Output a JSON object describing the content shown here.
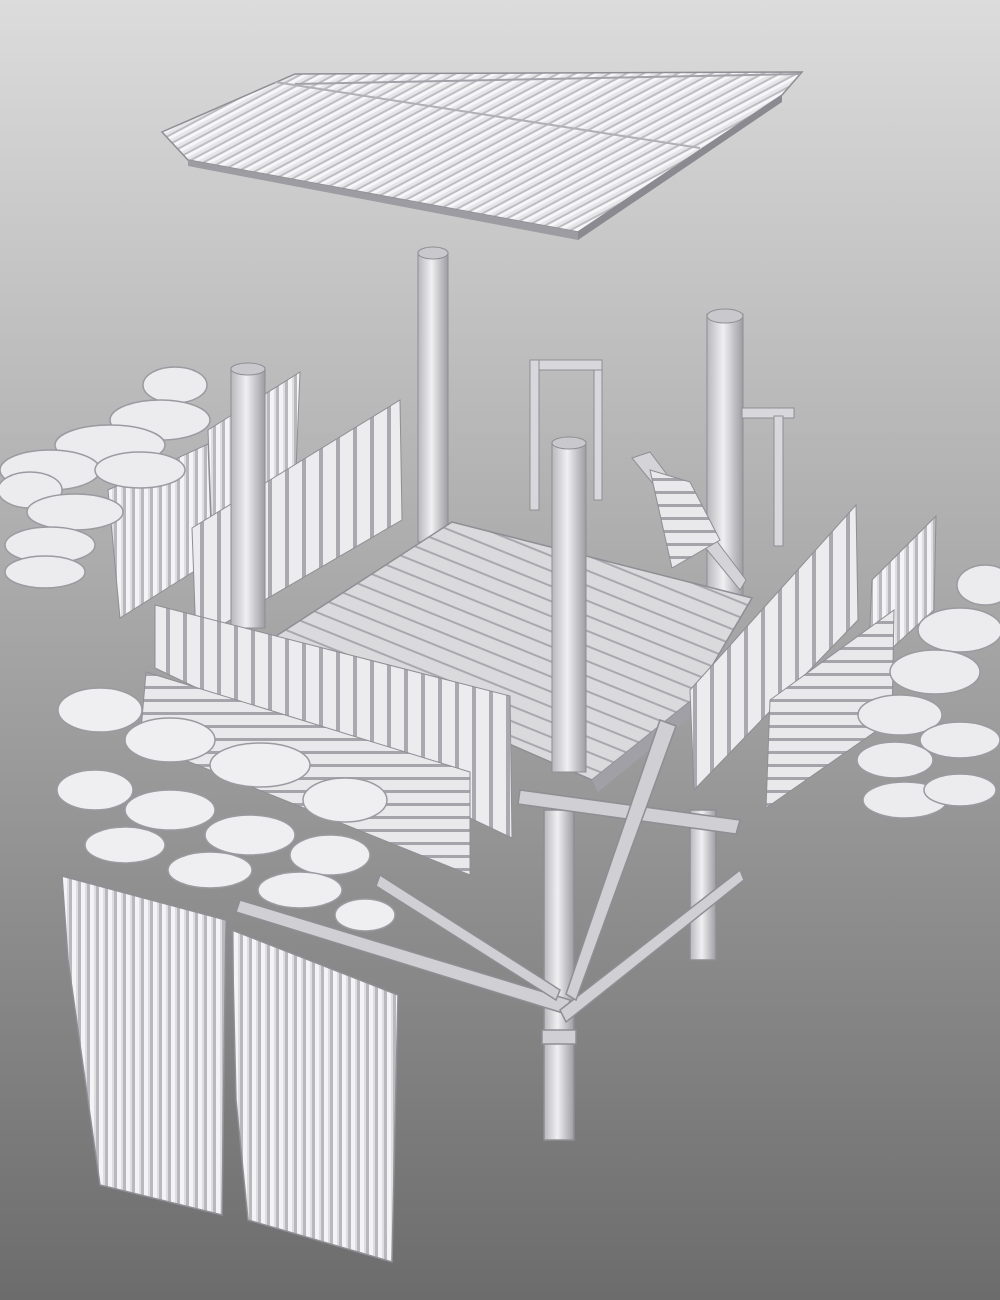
{
  "scene": {
    "subject": "exploded-view-3d-render-watchtower",
    "parts": [
      "roof",
      "posts",
      "deck",
      "railings",
      "ladder",
      "sandbags",
      "corrugated-panels",
      "support-frame"
    ]
  },
  "colors": {
    "bg_top": "#dcdcdc",
    "bg_bottom": "#6f6f6f",
    "model_light": "#f2f2f4",
    "model_mid": "#cfcfd2",
    "model_shadow": "#9a9aa0",
    "model_edge": "#7a7a80"
  }
}
